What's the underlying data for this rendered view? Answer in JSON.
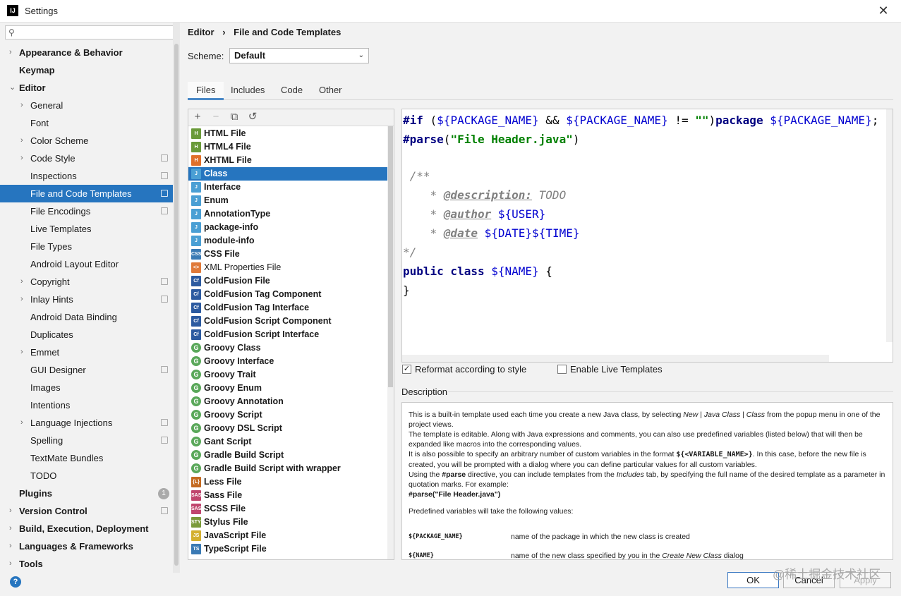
{
  "window": {
    "title": "Settings",
    "app_icon_text": "IJ"
  },
  "search": {
    "placeholder": ""
  },
  "tree": [
    {
      "label": "Appearance & Behavior",
      "bold": true,
      "indent": 0,
      "arrow": "›",
      "badge": ""
    },
    {
      "label": "Keymap",
      "bold": true,
      "indent": 0,
      "arrow": "",
      "badge": ""
    },
    {
      "label": "Editor",
      "bold": true,
      "indent": 0,
      "arrow": "⌄",
      "badge": ""
    },
    {
      "label": "General",
      "bold": false,
      "indent": 1,
      "arrow": "›",
      "badge": ""
    },
    {
      "label": "Font",
      "bold": false,
      "indent": 1,
      "arrow": "",
      "badge": ""
    },
    {
      "label": "Color Scheme",
      "bold": false,
      "indent": 1,
      "arrow": "›",
      "badge": ""
    },
    {
      "label": "Code Style",
      "bold": false,
      "indent": 1,
      "arrow": "›",
      "badge": "copy"
    },
    {
      "label": "Inspections",
      "bold": false,
      "indent": 1,
      "arrow": "",
      "badge": "copy"
    },
    {
      "label": "File and Code Templates",
      "bold": false,
      "indent": 1,
      "arrow": "",
      "badge": "copy",
      "selected": true
    },
    {
      "label": "File Encodings",
      "bold": false,
      "indent": 1,
      "arrow": "",
      "badge": "copy"
    },
    {
      "label": "Live Templates",
      "bold": false,
      "indent": 1,
      "arrow": "",
      "badge": ""
    },
    {
      "label": "File Types",
      "bold": false,
      "indent": 1,
      "arrow": "",
      "badge": ""
    },
    {
      "label": "Android Layout Editor",
      "bold": false,
      "indent": 1,
      "arrow": "",
      "badge": ""
    },
    {
      "label": "Copyright",
      "bold": false,
      "indent": 1,
      "arrow": "›",
      "badge": "copy"
    },
    {
      "label": "Inlay Hints",
      "bold": false,
      "indent": 1,
      "arrow": "›",
      "badge": "copy"
    },
    {
      "label": "Android Data Binding",
      "bold": false,
      "indent": 1,
      "arrow": "",
      "badge": ""
    },
    {
      "label": "Duplicates",
      "bold": false,
      "indent": 1,
      "arrow": "",
      "badge": ""
    },
    {
      "label": "Emmet",
      "bold": false,
      "indent": 1,
      "arrow": "›",
      "badge": ""
    },
    {
      "label": "GUI Designer",
      "bold": false,
      "indent": 1,
      "arrow": "",
      "badge": "copy"
    },
    {
      "label": "Images",
      "bold": false,
      "indent": 1,
      "arrow": "",
      "badge": ""
    },
    {
      "label": "Intentions",
      "bold": false,
      "indent": 1,
      "arrow": "",
      "badge": ""
    },
    {
      "label": "Language Injections",
      "bold": false,
      "indent": 1,
      "arrow": "›",
      "badge": "copy"
    },
    {
      "label": "Spelling",
      "bold": false,
      "indent": 1,
      "arrow": "",
      "badge": "copy"
    },
    {
      "label": "TextMate Bundles",
      "bold": false,
      "indent": 1,
      "arrow": "",
      "badge": ""
    },
    {
      "label": "TODO",
      "bold": false,
      "indent": 1,
      "arrow": "",
      "badge": ""
    },
    {
      "label": "Plugins",
      "bold": true,
      "indent": 0,
      "arrow": "",
      "badge": "1"
    },
    {
      "label": "Version Control",
      "bold": true,
      "indent": 0,
      "arrow": "›",
      "badge": "copy"
    },
    {
      "label": "Build, Execution, Deployment",
      "bold": true,
      "indent": 0,
      "arrow": "›",
      "badge": ""
    },
    {
      "label": "Languages & Frameworks",
      "bold": true,
      "indent": 0,
      "arrow": "›",
      "badge": ""
    },
    {
      "label": "Tools",
      "bold": true,
      "indent": 0,
      "arrow": "›",
      "badge": ""
    }
  ],
  "breadcrumb": {
    "parent": "Editor",
    "sep": "›",
    "current": "File and Code Templates"
  },
  "scheme": {
    "label": "Scheme:",
    "value": "Default"
  },
  "tabs": [
    "Files",
    "Includes",
    "Code",
    "Other"
  ],
  "toolbar": {
    "add": "+",
    "remove": "−",
    "copy": "⧉",
    "reset": "↺"
  },
  "files": [
    {
      "name": "HTML File",
      "icon": "H",
      "color": "#6a9a3a"
    },
    {
      "name": "HTML4 File",
      "icon": "H",
      "color": "#6a9a3a"
    },
    {
      "name": "XHTML File",
      "icon": "H",
      "color": "#e0702a"
    },
    {
      "name": "Class",
      "icon": "J",
      "color": "#4a9fd4",
      "selected": true
    },
    {
      "name": "Interface",
      "icon": "J",
      "color": "#4a9fd4"
    },
    {
      "name": "Enum",
      "icon": "J",
      "color": "#4a9fd4"
    },
    {
      "name": "AnnotationType",
      "icon": "J",
      "color": "#4a9fd4"
    },
    {
      "name": "package-info",
      "icon": "J",
      "color": "#4a9fd4"
    },
    {
      "name": "module-info",
      "icon": "J",
      "color": "#4a9fd4"
    },
    {
      "name": "CSS File",
      "icon": "CSS",
      "color": "#3a7ab4"
    },
    {
      "name": "XML Properties File",
      "icon": "<>",
      "color": "#e07a3a",
      "plain": true
    },
    {
      "name": "ColdFusion File",
      "icon": "Cf",
      "color": "#2c5aa0"
    },
    {
      "name": "ColdFusion Tag Component",
      "icon": "Cf",
      "color": "#2c5aa0"
    },
    {
      "name": "ColdFusion Tag Interface",
      "icon": "Cf",
      "color": "#2c5aa0"
    },
    {
      "name": "ColdFusion Script Component",
      "icon": "Cf",
      "color": "#2c5aa0"
    },
    {
      "name": "ColdFusion Script Interface",
      "icon": "Cf",
      "color": "#2c5aa0"
    },
    {
      "name": "Groovy Class",
      "icon": "G",
      "color": "#5aa85a",
      "round": true
    },
    {
      "name": "Groovy Interface",
      "icon": "G",
      "color": "#5aa85a",
      "round": true
    },
    {
      "name": "Groovy Trait",
      "icon": "G",
      "color": "#5aa85a",
      "round": true
    },
    {
      "name": "Groovy Enum",
      "icon": "G",
      "color": "#5aa85a",
      "round": true
    },
    {
      "name": "Groovy Annotation",
      "icon": "G",
      "color": "#5aa85a",
      "round": true
    },
    {
      "name": "Groovy Script",
      "icon": "G",
      "color": "#5aa85a",
      "round": true
    },
    {
      "name": "Groovy DSL Script",
      "icon": "G",
      "color": "#5aa85a",
      "round": true
    },
    {
      "name": "Gant Script",
      "icon": "G",
      "color": "#5aa85a",
      "round": true
    },
    {
      "name": "Gradle Build Script",
      "icon": "G",
      "color": "#5aa85a",
      "round": true
    },
    {
      "name": "Gradle Build Script with wrapper",
      "icon": "G",
      "color": "#5aa85a",
      "round": true
    },
    {
      "name": "Less File",
      "icon": "{L}",
      "color": "#c46a20"
    },
    {
      "name": "Sass File",
      "icon": "SASS",
      "color": "#c0466e"
    },
    {
      "name": "SCSS File",
      "icon": "SASS",
      "color": "#c0466e"
    },
    {
      "name": "Stylus File",
      "icon": "STYL",
      "color": "#7a9a3a"
    },
    {
      "name": "JavaScript File",
      "icon": "JS",
      "color": "#d4b030"
    },
    {
      "name": "TypeScript File",
      "icon": "TS",
      "color": "#3a7ab4"
    }
  ],
  "code": {
    "l1": [
      [
        "#if",
        "kw"
      ],
      [
        " (",
        "plain-code"
      ],
      [
        "${PACKAGE_NAME}",
        "var"
      ],
      [
        " && ",
        "plain-code"
      ],
      [
        "${PACKAGE_NAME}",
        "var"
      ],
      [
        " != ",
        "plain-code"
      ],
      [
        "\"\"",
        "str"
      ],
      [
        ")",
        "plain-code"
      ],
      [
        "package ",
        "kw"
      ],
      [
        "${PACKAGE_NAME}",
        "var"
      ],
      [
        ";",
        "plain-code"
      ]
    ],
    "l2": [
      [
        "#parse",
        "kw"
      ],
      [
        "(",
        "plain-code"
      ],
      [
        "\"File Header.java\"",
        "str"
      ],
      [
        ")",
        "plain-code"
      ]
    ],
    "l3": [],
    "l4": [
      [
        " /**",
        "cmt"
      ]
    ],
    "l5": [
      [
        "    * ",
        "cmt"
      ],
      [
        "@description:",
        "tag"
      ],
      [
        " TODO",
        "cmt"
      ]
    ],
    "l6": [
      [
        "    * ",
        "cmt"
      ],
      [
        "@author",
        "tag"
      ],
      [
        " ",
        "plain-code"
      ],
      [
        "${USER}",
        "var"
      ]
    ],
    "l7": [
      [
        "    * ",
        "cmt"
      ],
      [
        "@date",
        "tag"
      ],
      [
        " ",
        "plain-code"
      ],
      [
        "${DATE}",
        "var"
      ],
      [
        "${TIME}",
        "var"
      ]
    ],
    "l8": [
      [
        "*/",
        "cmt"
      ]
    ],
    "l9": [
      [
        "public class ",
        "kw"
      ],
      [
        "${NAME}",
        "var"
      ],
      [
        " {",
        "plain-code"
      ]
    ],
    "l10": [
      [
        "}",
        "plain-code"
      ]
    ]
  },
  "options": {
    "reformat": "Reformat according to style",
    "reformat_checked": "✓",
    "live": "Enable Live Templates"
  },
  "description": {
    "label": "Description",
    "p1a": "This is a built-in template used each time you create a new Java class, by selecting ",
    "p1b": "New",
    "p1c": " | ",
    "p1d": "Java Class",
    "p1e": " | ",
    "p1f": "Class",
    "p1g": " from the popup menu in one of the project views.",
    "p2": "The template is editable. Along with Java expressions and comments, you can also use predefined variables (listed below) that will then be expanded like macros into the corresponding values.",
    "p3a": "It is also possible to specify an arbitrary number of custom variables in the format ",
    "p3b": "${<VARIABLE_NAME>}",
    "p3c": ". In this case, before the new file is created, you will be prompted with a dialog where you can define particular values for all custom variables.",
    "p4a": "Using the ",
    "p4b": "#parse",
    "p4c": " directive, you can include templates from the ",
    "p4d": "Includes",
    "p4e": " tab, by specifying the full name of the desired template as a parameter in quotation marks. For example:",
    "p4f": "#parse(\"File Header.java\")",
    "p5": "Predefined variables will take the following values:",
    "v1name": "${PACKAGE_NAME}",
    "v1desc": "name of the package in which the new class is created",
    "v2name": "${NAME}",
    "v2desca": "name of the new class specified by you in the ",
    "v2descb": "Create New Class",
    "v2descc": " dialog"
  },
  "buttons": {
    "ok": "OK",
    "cancel": "Cancel",
    "apply": "Apply",
    "help": "?"
  },
  "watermark": "@稀土掘金技术社区"
}
